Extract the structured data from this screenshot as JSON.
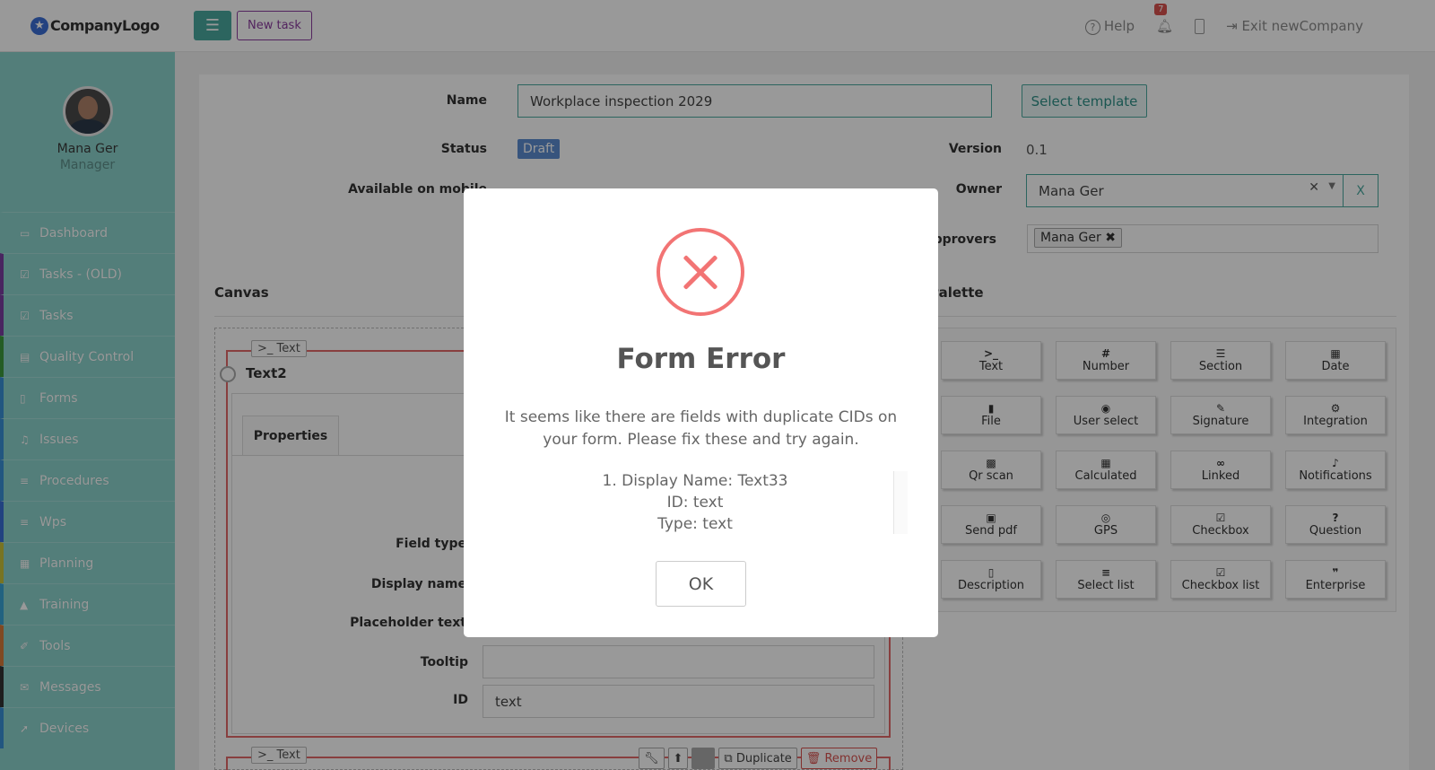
{
  "logo": {
    "text": "CompanyLogo",
    "icon": "star-icon"
  },
  "profile": {
    "name": "Mana Ger",
    "role": "Manager"
  },
  "sidebar": {
    "items": [
      {
        "label": "Dashboard",
        "icon": "monitor-icon",
        "color": "#8bd3cc"
      },
      {
        "label": "Tasks - (OLD)",
        "icon": "check-square-icon",
        "color": "#7b3fa0"
      },
      {
        "label": "Tasks",
        "icon": "check-square-icon",
        "color": "#7b3fa0"
      },
      {
        "label": "Quality Control",
        "icon": "book-icon",
        "color": "#3d9a3d"
      },
      {
        "label": "Forms",
        "icon": "file-icon",
        "color": "#3a8fd6"
      },
      {
        "label": "Issues",
        "icon": "bell-icon",
        "color": "#3a8fd6"
      },
      {
        "label": "Procedures",
        "icon": "list-icon",
        "color": "#3a8fd6"
      },
      {
        "label": "Wps",
        "icon": "list-icon",
        "color": "#3a6fd6"
      },
      {
        "label": "Planning",
        "icon": "calendar-icon",
        "color": "#c9c23a"
      },
      {
        "label": "Training",
        "icon": "graduation-cap-icon",
        "color": "#3aa4d6"
      },
      {
        "label": "Tools",
        "icon": "wrench-icon",
        "color": "#d67a3a"
      },
      {
        "label": "Messages",
        "icon": "envelope-icon",
        "color": "#333333"
      },
      {
        "label": "Devices",
        "icon": "rocket-icon",
        "color": "#3a8fd6"
      }
    ]
  },
  "topbar": {
    "new_task": "New task",
    "help": "Help",
    "notifications_count": "7",
    "exit": "Exit newCompany"
  },
  "form": {
    "name_label": "Name",
    "name_value": "Workplace inspection 2029",
    "select_template": "Select template",
    "status_label": "Status",
    "status_value": "Draft",
    "version_label": "Version",
    "version_value": "0.1",
    "mobile_label": "Available on mobile",
    "owner_label": "Owner",
    "owner_value": "Mana Ger",
    "owner_clear": "X",
    "approvers_label": "Approvers",
    "approver_tag": "Mana Ger"
  },
  "canvas": {
    "title": "Canvas",
    "field_tab": ">_ Text",
    "field_name": "Text2",
    "props_tab": "Properties",
    "labels": {
      "field_type": "Field type",
      "display_name": "Display name",
      "placeholder": "Placeholder text",
      "tooltip": "Tooltip",
      "id": "ID"
    },
    "id_value": "text",
    "next_field_tab": ">_ Text",
    "duplicate": "Duplicate",
    "remove": "Remove"
  },
  "palette": {
    "title": "Palette",
    "items": [
      {
        "label": "Text",
        "icon": ">_"
      },
      {
        "label": "Number",
        "icon": "#"
      },
      {
        "label": "Section",
        "icon": "☰"
      },
      {
        "label": "Date",
        "icon": "▦"
      },
      {
        "label": "File",
        "icon": "▮"
      },
      {
        "label": "User select",
        "icon": "◉"
      },
      {
        "label": "Signature",
        "icon": "✎"
      },
      {
        "label": "Integration",
        "icon": "⚙"
      },
      {
        "label": "Qr scan",
        "icon": "▩"
      },
      {
        "label": "Calculated",
        "icon": "▦"
      },
      {
        "label": "Linked",
        "icon": "∞"
      },
      {
        "label": "Notifications",
        "icon": "♪"
      },
      {
        "label": "Send pdf",
        "icon": "▣"
      },
      {
        "label": "GPS",
        "icon": "◎"
      },
      {
        "label": "Checkbox",
        "icon": "☑"
      },
      {
        "label": "Question",
        "icon": "?"
      },
      {
        "label": "Description",
        "icon": "▯"
      },
      {
        "label": "Select list",
        "icon": "≡"
      },
      {
        "label": "Checkbox list",
        "icon": "☑"
      },
      {
        "label": "Enterprise",
        "icon": "❞"
      }
    ]
  },
  "modal": {
    "title": "Form Error",
    "message": "It seems like there are fields with duplicate CIDs on your form. Please fix these and try again.",
    "list_line1": "1. Display Name: Text33",
    "list_line2": "ID: text",
    "list_line3": "Type: text",
    "ok": "OK",
    "icon": "error-x-icon",
    "accent": "#f27474"
  }
}
